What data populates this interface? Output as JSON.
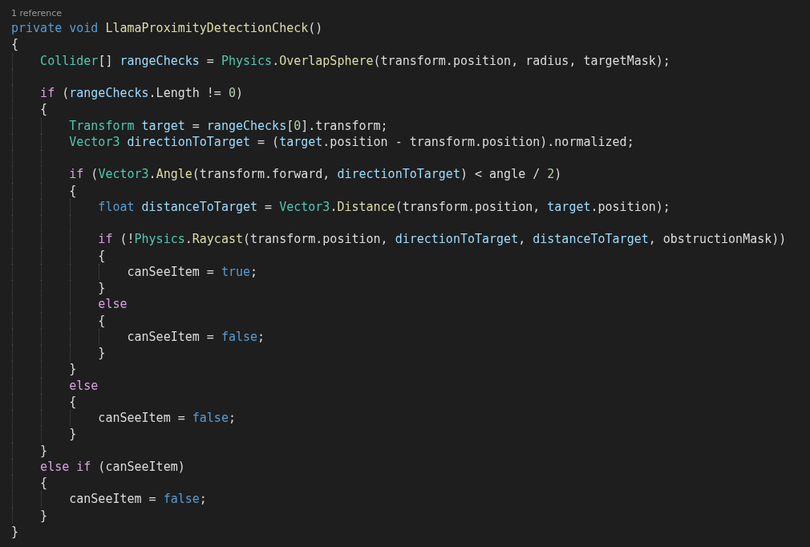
{
  "codelens": "1 reference",
  "blocks": [
    {
      "lines": [
        {
          "tokens": [
            {
              "kind": "keyword",
              "text": "private"
            },
            {
              "kind": "keyword",
              "text": " void"
            },
            {
              "kind": "method",
              "text": " LlamaProximityDetectionCheck"
            },
            {
              "kind": "plain",
              "text": "()"
            }
          ]
        },
        {
          "tokens": [
            {
              "kind": "plain",
              "text": "{"
            }
          ]
        },
        {
          "tokens": [
            {
              "kind": "type",
              "text": "    Collider"
            },
            {
              "kind": "plain",
              "text": "[] "
            },
            {
              "kind": "local",
              "text": "rangeChecks"
            },
            {
              "kind": "plain",
              "text": " = "
            },
            {
              "kind": "type",
              "text": "Physics"
            },
            {
              "kind": "plain",
              "text": "."
            },
            {
              "kind": "method",
              "text": "OverlapSphere"
            },
            {
              "kind": "plain",
              "text": "(transform.position, radius, targetMask);"
            }
          ]
        }
      ]
    },
    {
      "lines": [
        {
          "tokens": [
            {
              "kind": "control",
              "text": "    if"
            },
            {
              "kind": "plain",
              "text": " ("
            },
            {
              "kind": "local",
              "text": "rangeChecks"
            },
            {
              "kind": "plain",
              "text": ".Length != "
            },
            {
              "kind": "number",
              "text": "0"
            },
            {
              "kind": "plain",
              "text": ")"
            }
          ]
        },
        {
          "tokens": [
            {
              "kind": "plain",
              "text": "    {"
            }
          ]
        },
        {
          "tokens": [
            {
              "kind": "type",
              "text": "        Transform"
            },
            {
              "kind": "local",
              "text": " target"
            },
            {
              "kind": "plain",
              "text": " = "
            },
            {
              "kind": "local",
              "text": "rangeChecks"
            },
            {
              "kind": "plain",
              "text": "["
            },
            {
              "kind": "number",
              "text": "0"
            },
            {
              "kind": "plain",
              "text": "].transform;"
            }
          ]
        },
        {
          "tokens": [
            {
              "kind": "type",
              "text": "        Vector3"
            },
            {
              "kind": "local",
              "text": " directionToTarget"
            },
            {
              "kind": "plain",
              "text": " = ("
            },
            {
              "kind": "local",
              "text": "target"
            },
            {
              "kind": "plain",
              "text": ".position - transform.position).normalized;"
            }
          ]
        }
      ]
    },
    {
      "lines": [
        {
          "tokens": [
            {
              "kind": "control",
              "text": "        if"
            },
            {
              "kind": "plain",
              "text": " ("
            },
            {
              "kind": "type",
              "text": "Vector3"
            },
            {
              "kind": "plain",
              "text": "."
            },
            {
              "kind": "method",
              "text": "Angle"
            },
            {
              "kind": "plain",
              "text": "(transform.forward, "
            },
            {
              "kind": "local",
              "text": "directionToTarget"
            },
            {
              "kind": "plain",
              "text": ") < angle / "
            },
            {
              "kind": "number",
              "text": "2"
            },
            {
              "kind": "plain",
              "text": ")"
            }
          ]
        },
        {
          "tokens": [
            {
              "kind": "plain",
              "text": "        {"
            }
          ]
        },
        {
          "tokens": [
            {
              "kind": "keyword",
              "text": "            float"
            },
            {
              "kind": "local",
              "text": " distanceToTarget"
            },
            {
              "kind": "plain",
              "text": " = "
            },
            {
              "kind": "type",
              "text": "Vector3"
            },
            {
              "kind": "plain",
              "text": "."
            },
            {
              "kind": "method",
              "text": "Distance"
            },
            {
              "kind": "plain",
              "text": "(transform.position, "
            },
            {
              "kind": "local",
              "text": "target"
            },
            {
              "kind": "plain",
              "text": ".position);"
            }
          ]
        }
      ]
    },
    {
      "lines": [
        {
          "tokens": [
            {
              "kind": "control",
              "text": "            if"
            },
            {
              "kind": "plain",
              "text": " (!"
            },
            {
              "kind": "type",
              "text": "Physics"
            },
            {
              "kind": "plain",
              "text": "."
            },
            {
              "kind": "method",
              "text": "Raycast"
            },
            {
              "kind": "plain",
              "text": "(transform.position, "
            },
            {
              "kind": "local",
              "text": "directionToTarget"
            },
            {
              "kind": "plain",
              "text": ", "
            },
            {
              "kind": "local",
              "text": "distanceToTarget"
            },
            {
              "kind": "plain",
              "text": ", obstructionMask))"
            }
          ]
        },
        {
          "tokens": [
            {
              "kind": "plain",
              "text": "            {"
            }
          ]
        },
        {
          "tokens": [
            {
              "kind": "plain",
              "text": "                canSeeItem = "
            },
            {
              "kind": "keyword",
              "text": "true"
            },
            {
              "kind": "plain",
              "text": ";"
            }
          ]
        },
        {
          "tokens": [
            {
              "kind": "plain",
              "text": "            }"
            }
          ]
        },
        {
          "tokens": [
            {
              "kind": "control",
              "text": "            else"
            }
          ]
        },
        {
          "tokens": [
            {
              "kind": "plain",
              "text": "            {"
            }
          ]
        },
        {
          "tokens": [
            {
              "kind": "plain",
              "text": "                canSeeItem = "
            },
            {
              "kind": "keyword",
              "text": "false"
            },
            {
              "kind": "plain",
              "text": ";"
            }
          ]
        },
        {
          "tokens": [
            {
              "kind": "plain",
              "text": "            }"
            }
          ]
        },
        {
          "tokens": [
            {
              "kind": "plain",
              "text": "        }"
            }
          ]
        },
        {
          "tokens": [
            {
              "kind": "control",
              "text": "        else"
            }
          ]
        },
        {
          "tokens": [
            {
              "kind": "plain",
              "text": "        {"
            }
          ]
        },
        {
          "tokens": [
            {
              "kind": "plain",
              "text": "            canSeeItem = "
            },
            {
              "kind": "keyword",
              "text": "false"
            },
            {
              "kind": "plain",
              "text": ";"
            }
          ]
        },
        {
          "tokens": [
            {
              "kind": "plain",
              "text": "        }"
            }
          ]
        },
        {
          "tokens": [
            {
              "kind": "plain",
              "text": "    }"
            }
          ]
        },
        {
          "tokens": [
            {
              "kind": "control",
              "text": "    else"
            },
            {
              "kind": "control",
              "text": " if"
            },
            {
              "kind": "plain",
              "text": " (canSeeItem)"
            }
          ]
        },
        {
          "tokens": [
            {
              "kind": "plain",
              "text": "    {"
            }
          ]
        },
        {
          "tokens": [
            {
              "kind": "plain",
              "text": "        canSeeItem = "
            },
            {
              "kind": "keyword",
              "text": "false"
            },
            {
              "kind": "plain",
              "text": ";"
            }
          ]
        },
        {
          "tokens": [
            {
              "kind": "plain",
              "text": "    }"
            }
          ]
        },
        {
          "tokens": [
            {
              "kind": "plain",
              "text": "}"
            }
          ]
        }
      ]
    }
  ]
}
